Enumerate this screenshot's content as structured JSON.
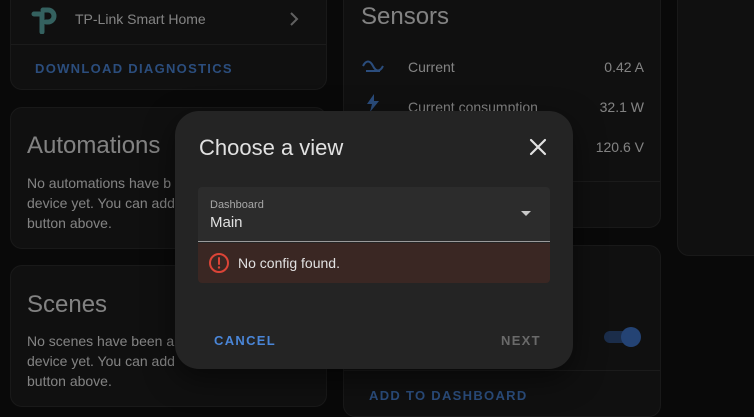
{
  "device": {
    "name": "TP-Link Smart Home",
    "download_diagnostics": "DOWNLOAD DIAGNOSTICS"
  },
  "automations": {
    "title": "Automations",
    "lines": [
      "No automations have b",
      "device yet. You can add",
      "button above."
    ]
  },
  "scenes": {
    "title": "Scenes",
    "lines": [
      "No scenes have been a",
      "device yet. You can add",
      "button above."
    ]
  },
  "sensors": {
    "title": "Sensors",
    "items": [
      {
        "label": "Current",
        "value": "0.42 A"
      },
      {
        "label": "Current consumption",
        "value": "32.1 W"
      },
      {
        "label": "",
        "value": "120.6 V"
      }
    ]
  },
  "controls": {
    "add_to_dashboard": "ADD TO DASHBOARD",
    "switch_on": true
  },
  "dialog": {
    "title": "Choose a view",
    "select_label": "Dashboard",
    "select_value": "Main",
    "error_text": "No config found.",
    "cancel_label": "CANCEL",
    "next_label": "NEXT"
  },
  "colors": {
    "accent": "#4a86d8",
    "error": "#db4437",
    "toggle": "#3f74c9"
  }
}
